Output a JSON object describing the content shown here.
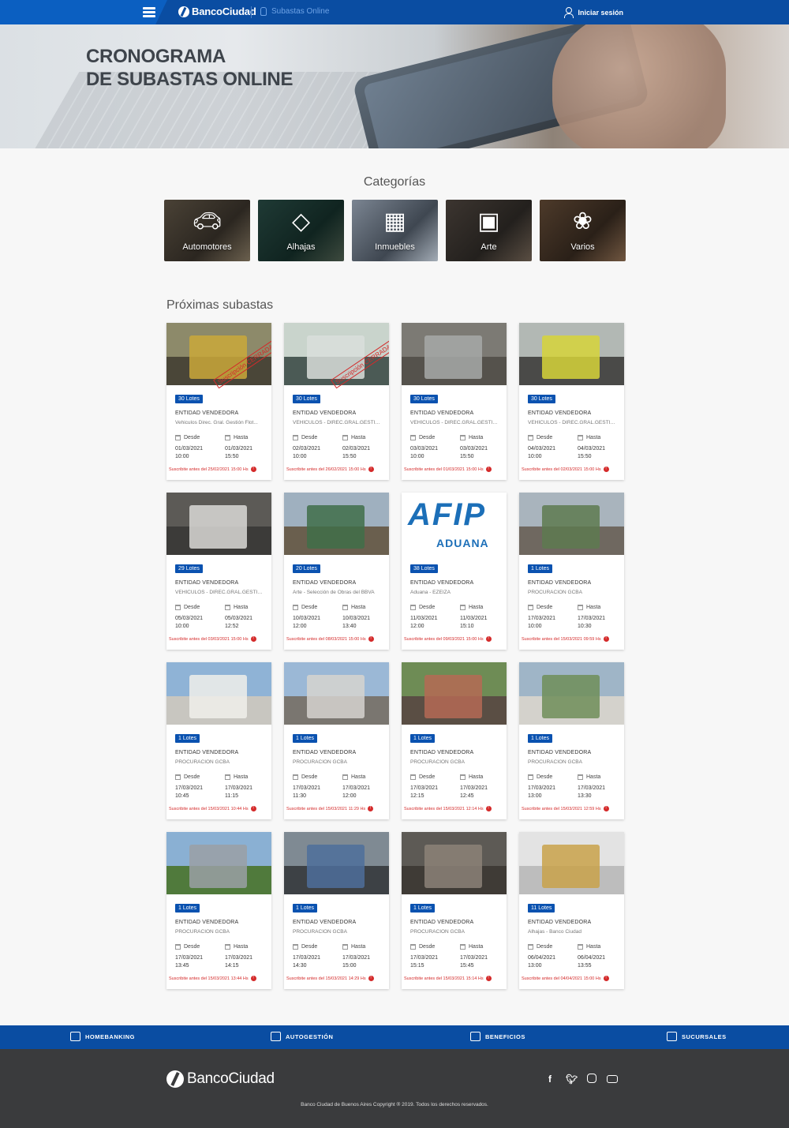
{
  "nav": {
    "brand": "BancoCiudad",
    "section": "Subastas Online",
    "login": "Iniciar sesión"
  },
  "hero": {
    "title_line1": "CRONOGRAMA",
    "title_line2": "DE SUBASTAS ONLINE"
  },
  "categories": {
    "title": "Categorías",
    "items": [
      {
        "label": "Automotores",
        "icon": "car-icon"
      },
      {
        "label": "Alhajas",
        "icon": "diamond-icon"
      },
      {
        "label": "Inmuebles",
        "icon": "building-icon"
      },
      {
        "label": "Arte",
        "icon": "frame-icon"
      },
      {
        "label": "Varios",
        "icon": "network-icon"
      }
    ]
  },
  "upcoming": {
    "title": "Próximas subastas",
    "desde_label": "Desde",
    "hasta_label": "Hasta",
    "entity_label": "ENTIDAD VENDEDORA",
    "cards": [
      {
        "lots": "30 Lotes",
        "sub": "Vehiculos Direc. Gral. Gestión Flot...",
        "from_date": "01/03/2021",
        "from_time": "10:00",
        "to_date": "01/03/2021",
        "to_time": "15:50",
        "deadline": "Suscribite antes del 25/02/2021 15:00 Hs",
        "stamp": "Suscripción CERRADA"
      },
      {
        "lots": "30 Lotes",
        "sub": "VEHÍCULOS - DIREC.GRAL.GESTIO...",
        "from_date": "02/03/2021",
        "from_time": "10:00",
        "to_date": "02/03/2021",
        "to_time": "15:50",
        "deadline": "Suscribite antes del 26/02/2021 15:00 Hs",
        "stamp": "Suscripción CERRADA"
      },
      {
        "lots": "30 Lotes",
        "sub": "VEHÍCULOS - DIREC.GRAL.GESTIO...",
        "from_date": "03/03/2021",
        "from_time": "10:00",
        "to_date": "03/03/2021",
        "to_time": "15:50",
        "deadline": "Suscribite antes del 01/03/2021 15:00 Hs",
        "stamp": ""
      },
      {
        "lots": "30 Lotes",
        "sub": "VEHÍCULOS - DIREC.GRAL.GESTIO...",
        "from_date": "04/03/2021",
        "from_time": "10:00",
        "to_date": "04/03/2021",
        "to_time": "15:50",
        "deadline": "Suscribite antes del 02/03/2021 15:00 Hs",
        "stamp": ""
      },
      {
        "lots": "29 Lotes",
        "sub": "VEHÍCULOS - DIREC.GRAL.GESTIO...",
        "from_date": "05/03/2021",
        "from_time": "10:00",
        "to_date": "05/03/2021",
        "to_time": "12:52",
        "deadline": "Suscribite antes del 03/03/2021 15:00 Hs",
        "stamp": ""
      },
      {
        "lots": "20 Lotes",
        "sub": "Arte - Selección de Obras del BBVA",
        "from_date": "10/03/2021",
        "from_time": "12:00",
        "to_date": "10/03/2021",
        "to_time": "13:40",
        "deadline": "Suscribite antes del 08/03/2021 15:00 Hs",
        "stamp": ""
      },
      {
        "lots": "38 Lotes",
        "sub": "Aduana - EZEIZA",
        "from_date": "11/03/2021",
        "from_time": "12:00",
        "to_date": "11/03/2021",
        "to_time": "15:10",
        "deadline": "Suscribite antes del 09/03/2021 15:00 Hs",
        "stamp": "",
        "afip": "AFIP",
        "aduana": "ADUANA"
      },
      {
        "lots": "1 Lotes",
        "sub": "PROCURACION GCBA",
        "from_date": "17/03/2021",
        "from_time": "10:00",
        "to_date": "17/03/2021",
        "to_time": "10:30",
        "deadline": "Suscribite antes del 15/03/2021 09:59 Hs",
        "stamp": ""
      },
      {
        "lots": "1 Lotes",
        "sub": "PROCURACION GCBA",
        "from_date": "17/03/2021",
        "from_time": "10:45",
        "to_date": "17/03/2021",
        "to_time": "11:15",
        "deadline": "Suscribite antes del 15/03/2021 10:44 Hs",
        "stamp": ""
      },
      {
        "lots": "1 Lotes",
        "sub": "PROCURACION GCBA",
        "from_date": "17/03/2021",
        "from_time": "11:30",
        "to_date": "17/03/2021",
        "to_time": "12:00",
        "deadline": "Suscribite antes del 15/03/2021 11:29 Hs",
        "stamp": ""
      },
      {
        "lots": "1 Lotes",
        "sub": "PROCURACION GCBA",
        "from_date": "17/03/2021",
        "from_time": "12:15",
        "to_date": "17/03/2021",
        "to_time": "12:45",
        "deadline": "Suscribite antes del 15/03/2021 12:14 Hs",
        "stamp": ""
      },
      {
        "lots": "1 Lotes",
        "sub": "PROCURACION GCBA",
        "from_date": "17/03/2021",
        "from_time": "13:00",
        "to_date": "17/03/2021",
        "to_time": "13:30",
        "deadline": "Suscribite antes del 15/03/2021 12:59 Hs",
        "stamp": ""
      },
      {
        "lots": "1 Lotes",
        "sub": "PROCURACION GCBA",
        "from_date": "17/03/2021",
        "from_time": "13:45",
        "to_date": "17/03/2021",
        "to_time": "14:15",
        "deadline": "Suscribite antes del 15/03/2021 13:44 Hs",
        "stamp": ""
      },
      {
        "lots": "1 Lotes",
        "sub": "PROCURACION GCBA",
        "from_date": "17/03/2021",
        "from_time": "14:30",
        "to_date": "17/03/2021",
        "to_time": "15:00",
        "deadline": "Suscribite antes del 15/03/2021 14:29 Hs",
        "stamp": ""
      },
      {
        "lots": "1 Lotes",
        "sub": "PROCURACION GCBA",
        "from_date": "17/03/2021",
        "from_time": "15:15",
        "to_date": "17/03/2021",
        "to_time": "15:45",
        "deadline": "Suscribite antes del 15/03/2021 15:14 Hs",
        "stamp": ""
      },
      {
        "lots": "11 Lotes",
        "sub": "Alhajas - Banco Ciudad",
        "from_date": "06/04/2021",
        "from_time": "13:00",
        "to_date": "06/04/2021",
        "to_time": "13:55",
        "deadline": "Suscribite antes del 04/04/2021 15:00 Hs",
        "stamp": ""
      }
    ]
  },
  "footer_bar": {
    "items": [
      {
        "label": "HOMEBANKING",
        "icon": "monitor-icon"
      },
      {
        "label": "AUTOGESTIÓN",
        "icon": "touch-icon"
      },
      {
        "label": "BENEFICIOS",
        "icon": "gift-icon"
      },
      {
        "label": "SUCURSALES",
        "icon": "branch-icon"
      }
    ]
  },
  "footer": {
    "brand": "BancoCiudad",
    "copyright": "Banco Ciudad de Buenos Aires Copyright ® 2019. Todos los derechos reservados.",
    "social": [
      "facebook-icon",
      "twitter-icon",
      "instagram-icon",
      "youtube-icon"
    ]
  },
  "colors": {
    "primary": "#0a4da2",
    "accent": "#0b5fc1",
    "alert": "#d42a2a",
    "footer_bg": "#3a3b3d"
  }
}
